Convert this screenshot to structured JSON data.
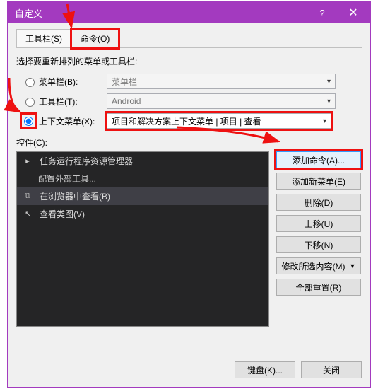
{
  "window": {
    "title": "自定义",
    "help": "?",
    "close": "✕"
  },
  "tabs": {
    "toolbar": "工具栏(S)",
    "commands": "命令(O)"
  },
  "section_label": "选择要重新排列的菜单或工具栏:",
  "radios": {
    "menubar": {
      "label": "菜单栏(B):",
      "value": "菜单栏"
    },
    "toolbar": {
      "label": "工具栏(T):",
      "value": "Android"
    },
    "context": {
      "label": "上下文菜单(X):",
      "value": "项目和解决方案上下文菜单 | 项目 | 查看"
    }
  },
  "controls_label": "控件(C):",
  "list": {
    "items": [
      {
        "icon": "▸",
        "label": "任务运行程序资源管理器"
      },
      {
        "icon": "",
        "label": "配置外部工具..."
      },
      {
        "icon": "⧉",
        "label": "在浏览器中查看(B)"
      },
      {
        "icon": "⇱",
        "label": "查看类图(V)"
      }
    ]
  },
  "side_buttons": {
    "add_cmd": "添加命令(A)...",
    "add_menu": "添加新菜单(E)",
    "delete": "删除(D)",
    "move_up": "上移(U)",
    "move_down": "下移(N)",
    "modify": "修改所选内容(M)",
    "reset_all": "全部重置(R)"
  },
  "footer": {
    "keyboard": "键盘(K)...",
    "close": "关闭"
  }
}
